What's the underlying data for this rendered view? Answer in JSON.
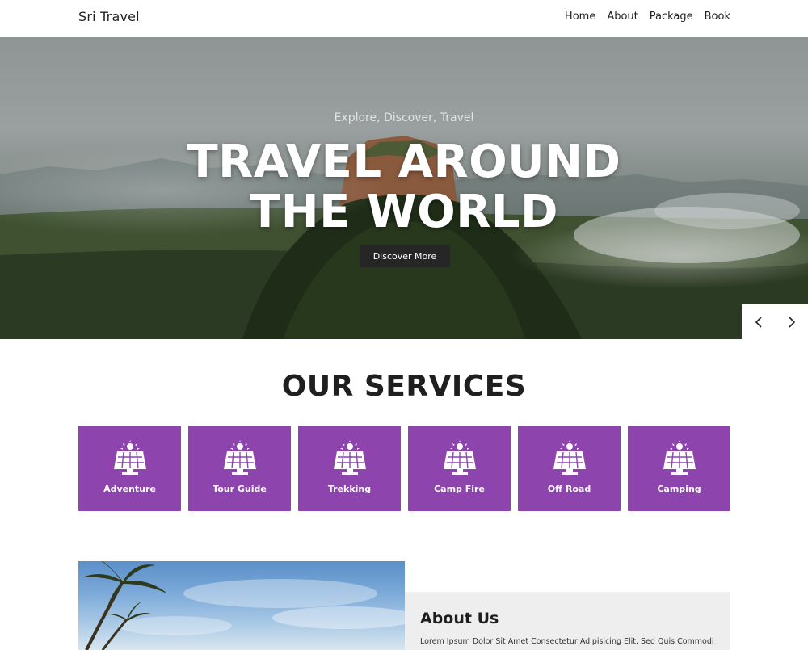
{
  "brand": "Sri Travel",
  "nav": {
    "items": [
      {
        "label": "Home"
      },
      {
        "label": "About"
      },
      {
        "label": "Package"
      },
      {
        "label": "Book"
      }
    ]
  },
  "hero": {
    "subtitle": "Explore, Discover, Travel",
    "title_line1": "TRAVEL AROUND",
    "title_line2": "THE WORLD",
    "button": "Discover More",
    "prev_icon": "chevron-left-icon",
    "next_icon": "chevron-right-icon"
  },
  "services": {
    "title": "OUR SERVICES",
    "accent": "#8e44ad",
    "icon": "solar-panel-icon",
    "items": [
      {
        "label": "Adventure"
      },
      {
        "label": "Tour Guide"
      },
      {
        "label": "Trekking"
      },
      {
        "label": "Camp Fire"
      },
      {
        "label": "Off Road"
      },
      {
        "label": "Camping"
      }
    ]
  },
  "about": {
    "title": "About Us",
    "text": "Lorem Ipsum Dolor Sit Amet Consectetur Adipisicing Elit. Sed Quis Commodi"
  }
}
